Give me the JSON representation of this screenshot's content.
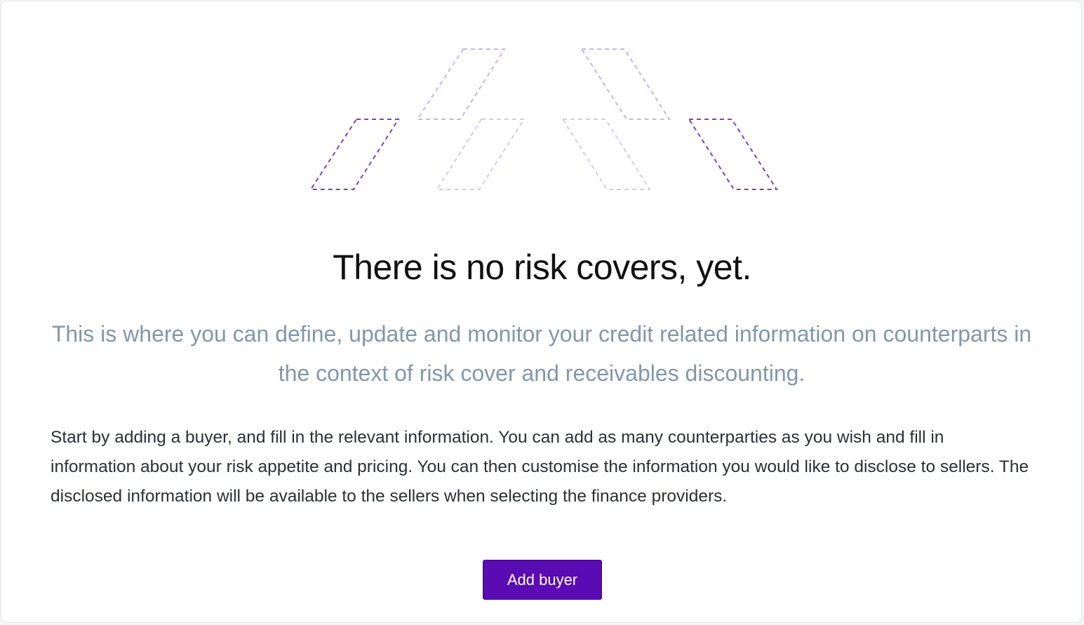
{
  "empty_state": {
    "title": "There is no risk covers, yet.",
    "subtitle": "This is where you can define, update and monitor your credit related information on counterparts in the context of risk cover and receivables discounting.",
    "description": "Start by adding a buyer, and fill in the relevant information. You can add as many counterparties as you wish and fill in information about your risk appetite and pricing. You can then customise the information you would like to disclose to sellers. The disclosed information will be available to the sellers when selecting the finance providers.",
    "add_button_label": "Add buyer",
    "illustration_icon": "dashed-parallelogram-logo-icon"
  },
  "colors": {
    "accent": "#5a0bb3",
    "illustration_strong": "#7b3fd0",
    "illustration_light": "#c9b2ee",
    "subtitle": "#8197ab",
    "body_text": "#2b2f36"
  }
}
